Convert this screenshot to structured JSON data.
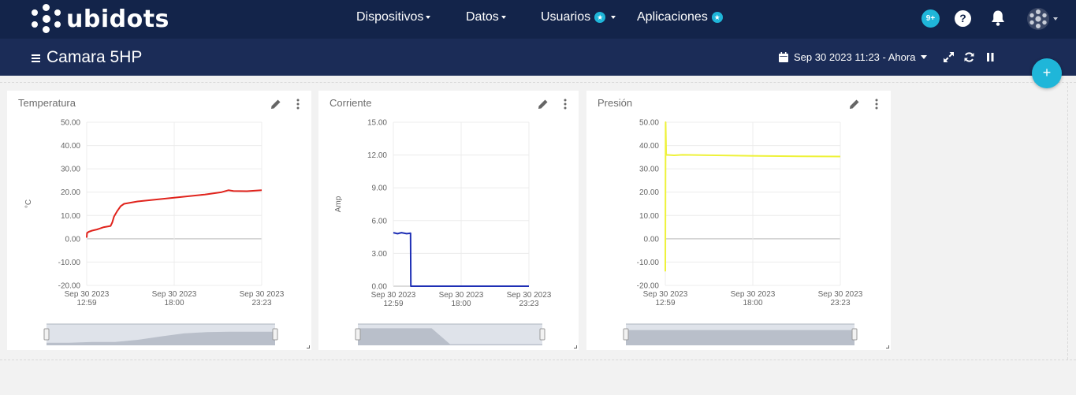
{
  "brand": {
    "name": "ubidots"
  },
  "nav": [
    {
      "label": "Dispositivos",
      "caret": true,
      "star": false
    },
    {
      "label": "Datos",
      "caret": true,
      "star": false
    },
    {
      "label": "Usuarios",
      "caret": true,
      "star": true
    },
    {
      "label": "Aplicaciones",
      "caret": false,
      "star": true
    }
  ],
  "notifications_badge": "9+",
  "help_label": "?",
  "dashboard": {
    "title": "Camara 5HP",
    "date_range": "Sep 30 2023 11:23 - Ahora",
    "add_label": "+"
  },
  "colors": {
    "navbar": "#13244a",
    "dashbar": "#1b2c57",
    "accent": "#1fb6d9"
  },
  "widgets": [
    {
      "title": "Temperatura"
    },
    {
      "title": "Corriente"
    },
    {
      "title": "Presión"
    }
  ],
  "chart_data": [
    {
      "type": "line",
      "title": "Temperatura",
      "ylabel": "°C",
      "ylim": [
        -20,
        50
      ],
      "yticks": [
        "50.00",
        "40.00",
        "30.00",
        "20.00",
        "10.00",
        "0.00",
        "-10.00",
        "-20.00"
      ],
      "xticks": [
        {
          "date": "Sep 30 2023",
          "time": "12:59"
        },
        {
          "date": "Sep 30 2023",
          "time": "18:00"
        },
        {
          "date": "Sep 30 2023",
          "time": "23:23"
        }
      ],
      "xlim_hours": [
        12.98,
        23.38
      ],
      "grid": true,
      "series": [
        {
          "color": "#e0231c",
          "points": [
            [
              12.98,
              0.5
            ],
            [
              13.0,
              2.5
            ],
            [
              13.1,
              3
            ],
            [
              13.3,
              3.5
            ],
            [
              13.6,
              4
            ],
            [
              14.0,
              5
            ],
            [
              14.4,
              5.5
            ],
            [
              14.5,
              7
            ],
            [
              14.6,
              9.5
            ],
            [
              14.8,
              12
            ],
            [
              15.0,
              14
            ],
            [
              15.2,
              15
            ],
            [
              16.0,
              16
            ],
            [
              18.0,
              17.5
            ],
            [
              20.0,
              19
            ],
            [
              21.0,
              20
            ],
            [
              21.4,
              20.8
            ],
            [
              21.7,
              20.5
            ],
            [
              22.5,
              20.4
            ],
            [
              23.38,
              20.8
            ]
          ]
        }
      ],
      "navigator": [
        0.12,
        0.12,
        0.16,
        0.16,
        0.26,
        0.42,
        0.56,
        0.62,
        0.64,
        0.64,
        0.64
      ]
    },
    {
      "type": "line",
      "title": "Corriente",
      "ylabel": "Amp",
      "ylim": [
        0,
        15
      ],
      "yticks": [
        "15.00",
        "12.00",
        "9.00",
        "6.00",
        "3.00",
        "0.00"
      ],
      "xticks": [
        {
          "date": "Sep 30 2023",
          "time": "12:59"
        },
        {
          "date": "Sep 30 2023",
          "time": "18:00"
        },
        {
          "date": "Sep 30 2023",
          "time": "23:23"
        }
      ],
      "xlim_hours": [
        12.98,
        23.38
      ],
      "grid": true,
      "series": [
        {
          "color": "#1e2fb5",
          "points": [
            [
              12.98,
              4.9
            ],
            [
              13.3,
              4.8
            ],
            [
              13.6,
              4.9
            ],
            [
              14.0,
              4.8
            ],
            [
              14.3,
              4.85
            ],
            [
              14.32,
              0
            ],
            [
              18.0,
              0
            ],
            [
              23.38,
              0
            ]
          ]
        }
      ],
      "navigator": [
        0.8,
        0.8,
        0.8,
        0.8,
        0.8,
        0.05,
        0.05,
        0.05,
        0.05,
        0.05,
        0.05
      ]
    },
    {
      "type": "line",
      "title": "Presión",
      "ylabel": "",
      "ylim": [
        -20,
        50
      ],
      "yticks": [
        "50.00",
        "40.00",
        "30.00",
        "20.00",
        "10.00",
        "0.00",
        "-10.00",
        "-20.00"
      ],
      "xticks": [
        {
          "date": "Sep 30 2023",
          "time": "12:59"
        },
        {
          "date": "Sep 30 2023",
          "time": "18:00"
        },
        {
          "date": "Sep 30 2023",
          "time": "23:23"
        }
      ],
      "xlim_hours": [
        12.98,
        23.38
      ],
      "grid": true,
      "series": [
        {
          "color": "#eef23a",
          "points": [
            [
              12.98,
              -14
            ],
            [
              13.0,
              50
            ],
            [
              13.03,
              36
            ],
            [
              13.5,
              35.8
            ],
            [
              14.0,
              36
            ],
            [
              16.0,
              35.8
            ],
            [
              18.0,
              35.6
            ],
            [
              21.0,
              35.4
            ],
            [
              23.38,
              35.3
            ]
          ]
        }
      ],
      "navigator": [
        0.72,
        0.72,
        0.72,
        0.72,
        0.72,
        0.72,
        0.72,
        0.72,
        0.72,
        0.72,
        0.72
      ]
    }
  ]
}
